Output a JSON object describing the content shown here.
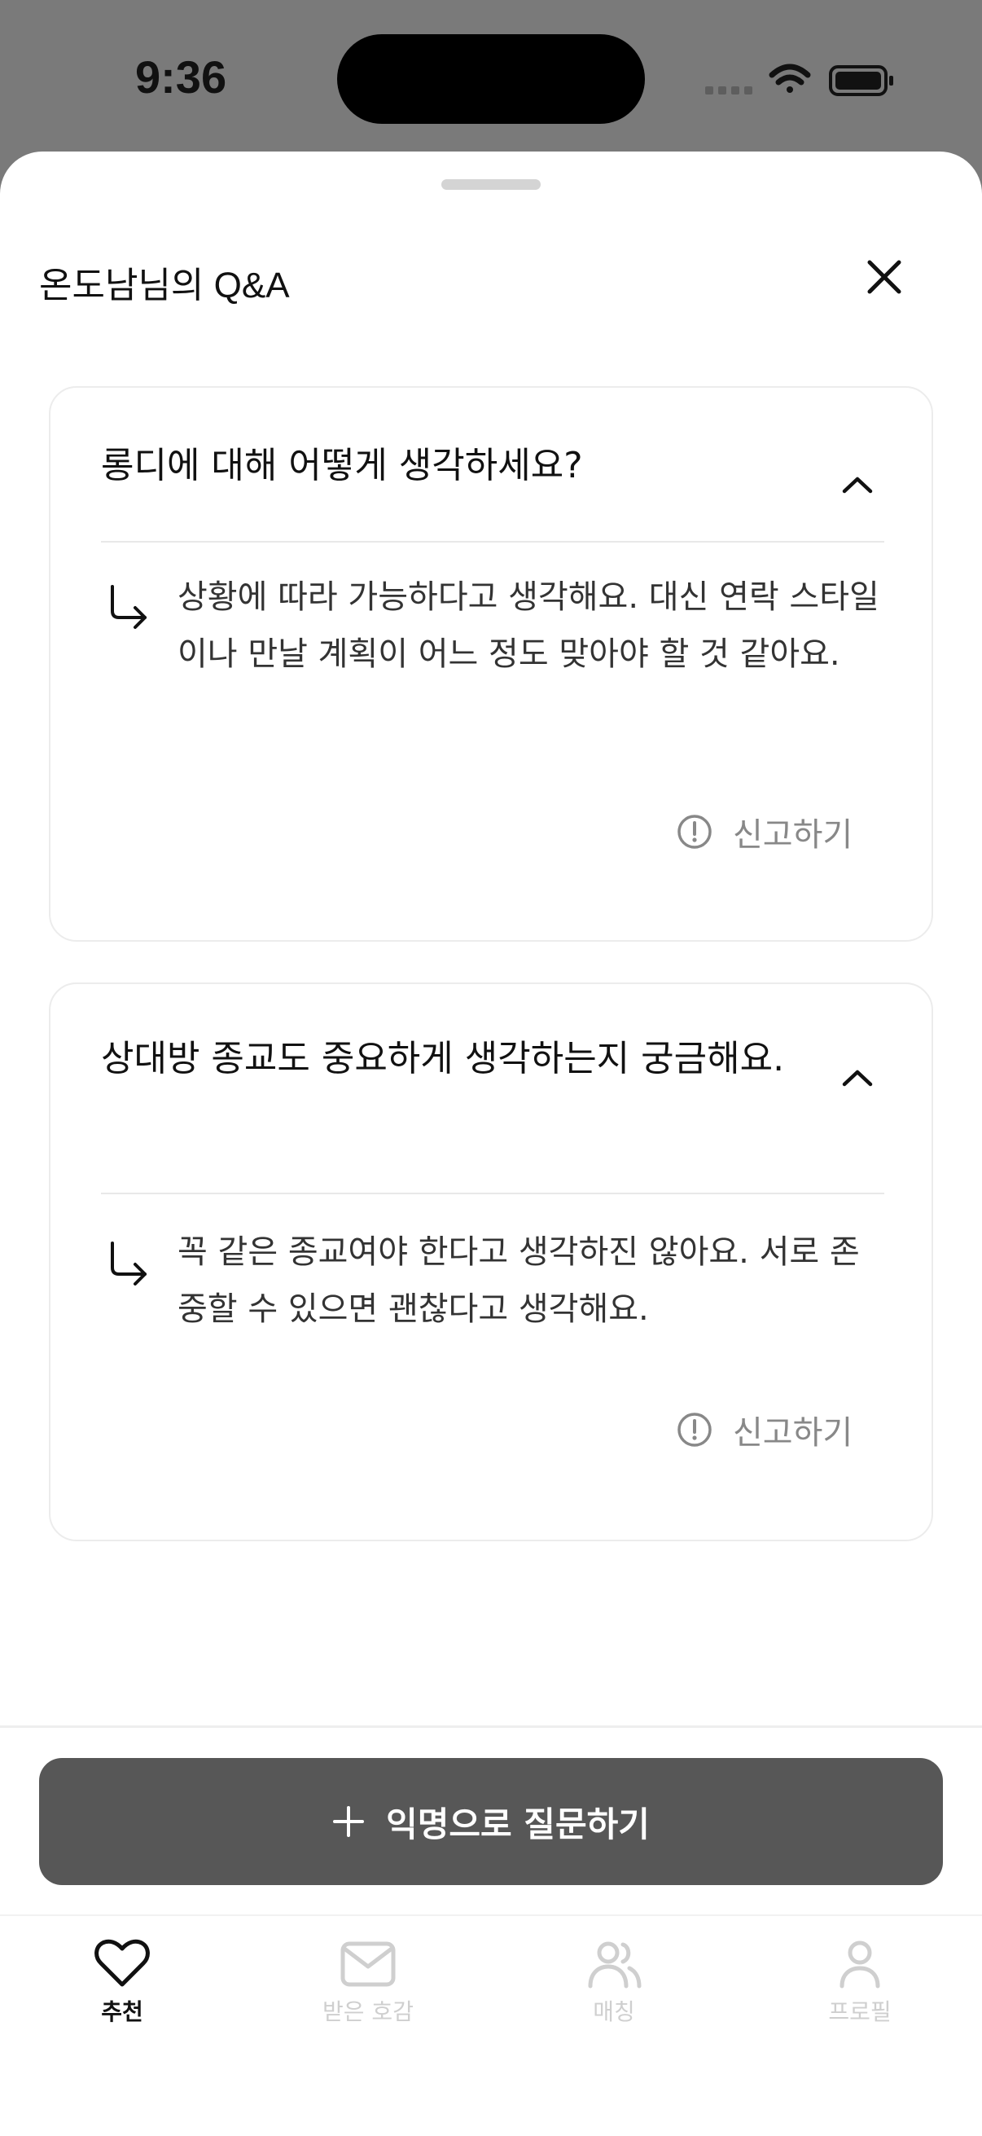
{
  "status_bar": {
    "time": "9:36"
  },
  "sheet": {
    "title": "온도남님의 Q&A"
  },
  "qa": [
    {
      "question": "롱디에 대해 어떻게 생각하세요?",
      "answer": "상황에 따라 가능하다고 생각해요. 대신 연락 스타일이나 만날 계획이 어느 정도 맞아야 할 것 같아요.",
      "report_label": "신고하기"
    },
    {
      "question": "상대방 종교도 중요하게 생각하는지 궁금해요.",
      "answer": "꼭 같은 종교여야 한다고 생각하진 않아요. 서로 존중할 수 있으면 괜찮다고 생각해요.",
      "report_label": "신고하기"
    }
  ],
  "ask_button": {
    "label": "익명으로 질문하기"
  },
  "tabs": [
    {
      "label": "추천",
      "icon": "heart-icon",
      "active": true
    },
    {
      "label": "받은 호감",
      "icon": "mail-icon",
      "active": false
    },
    {
      "label": "매칭",
      "icon": "users-icon",
      "active": false
    },
    {
      "label": "프로필",
      "icon": "user-icon",
      "active": false
    }
  ],
  "colors": {
    "backdrop": "#7a7a7a",
    "primary_button": "#575757",
    "active_tab": "#111111",
    "inactive_tab": "#cfcfcf",
    "muted_text": "#888888"
  }
}
